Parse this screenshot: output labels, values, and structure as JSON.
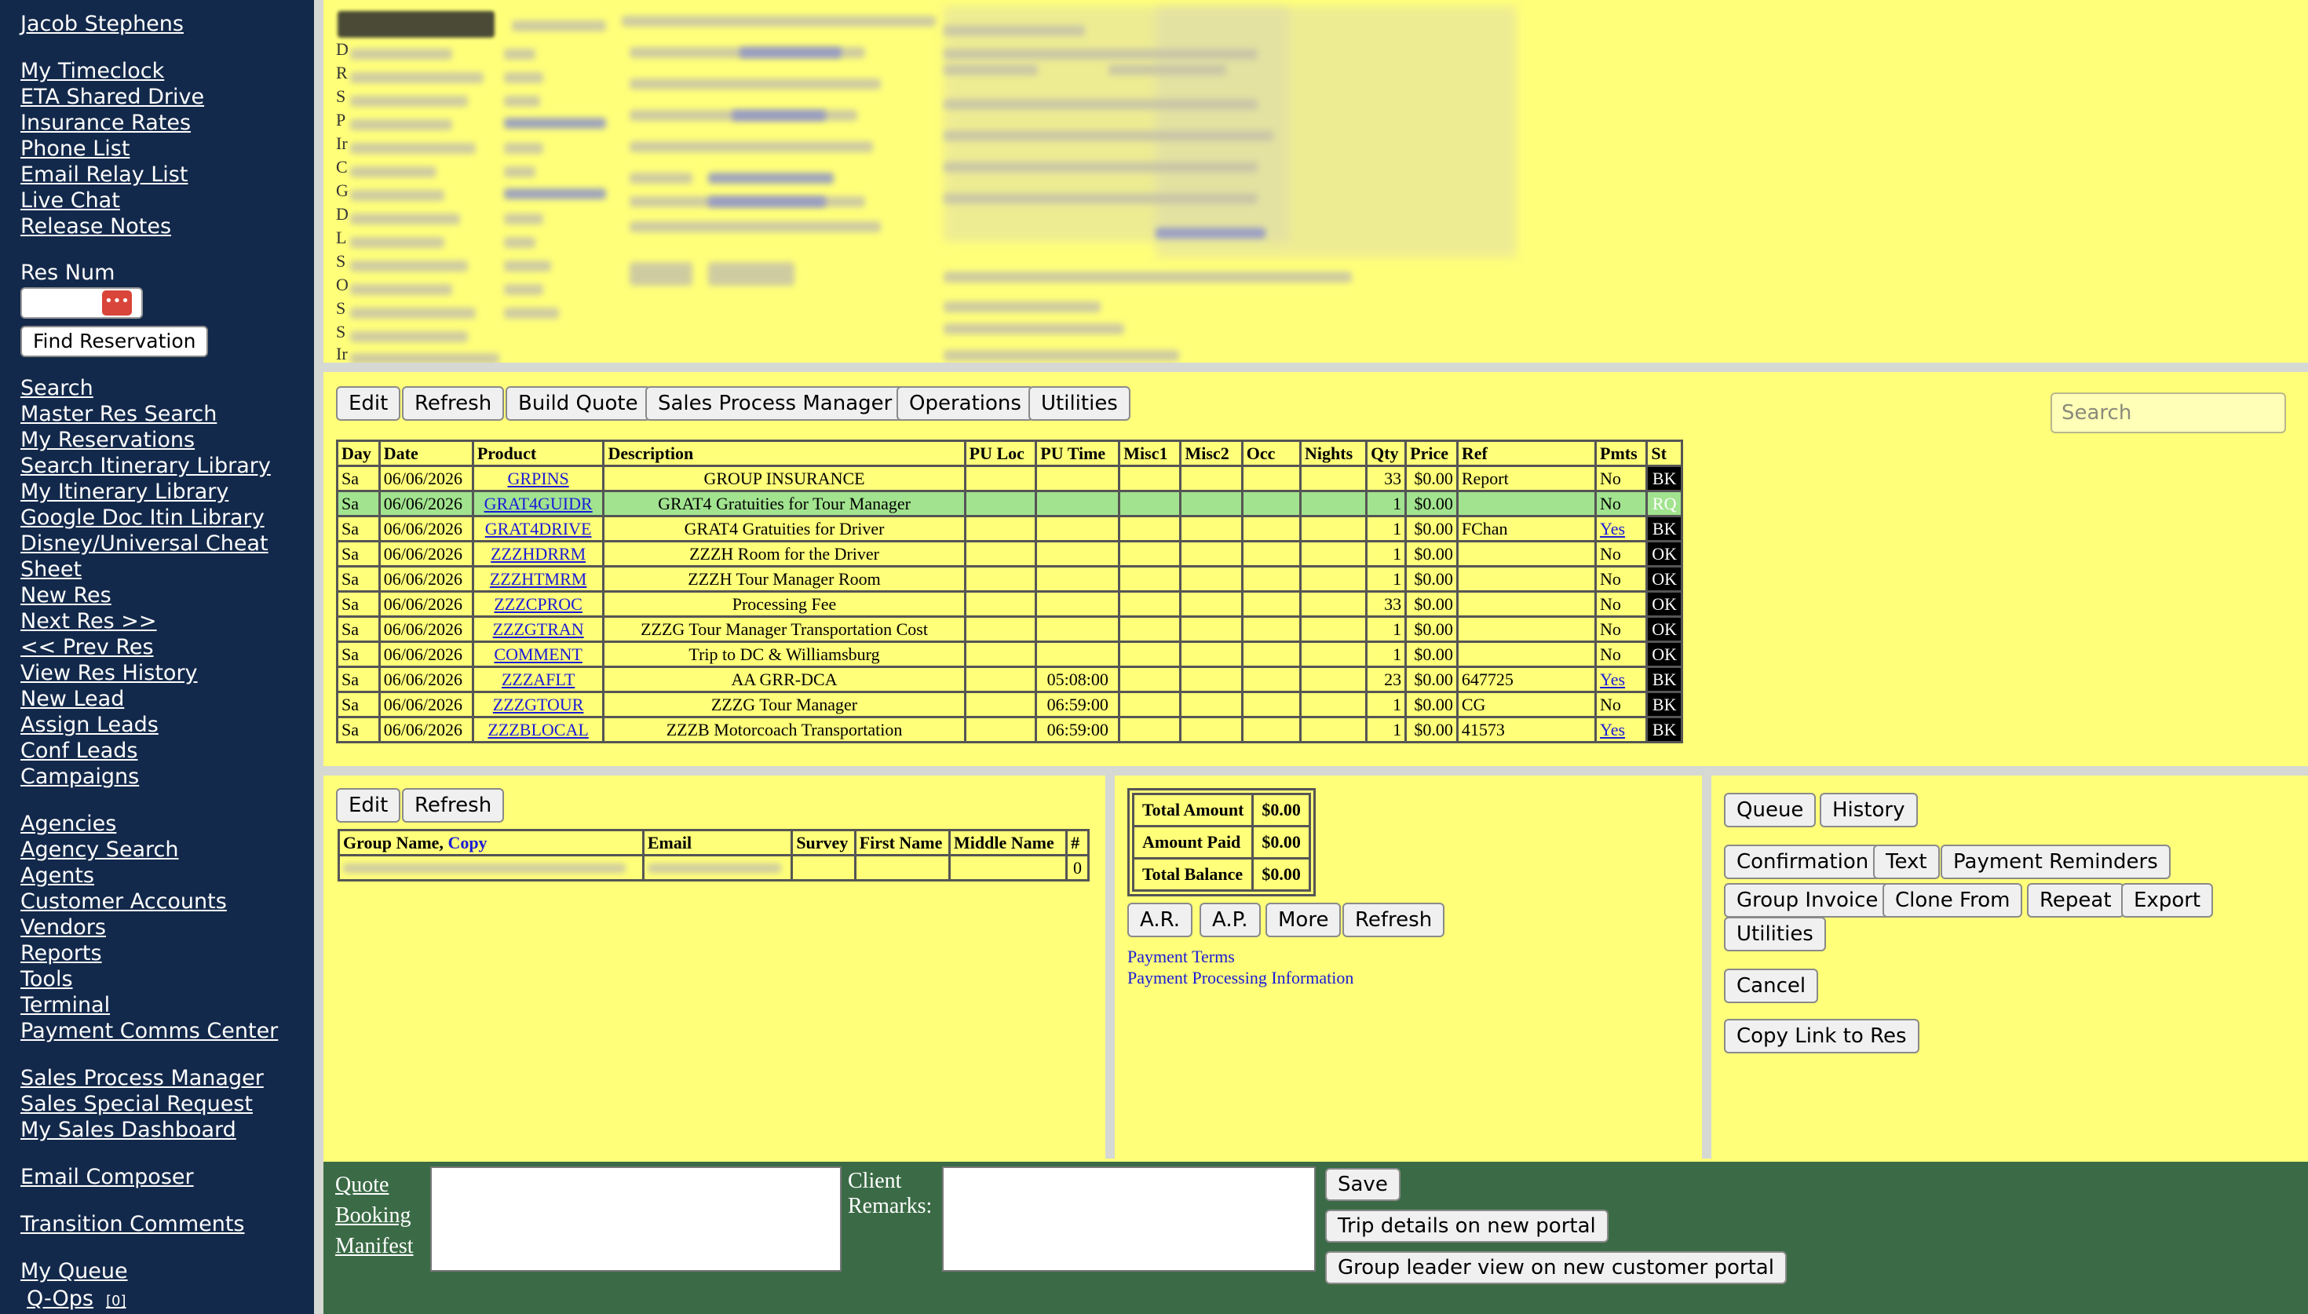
{
  "sidebar": {
    "user": "Jacob Stephens",
    "links_1": [
      "My Timeclock",
      "ETA Shared Drive",
      "Insurance Rates",
      "Phone List",
      "Email Relay List",
      "Live Chat",
      "Release Notes"
    ],
    "res_num_label": "Res Num",
    "find_button": "Find Reservation",
    "links_2": [
      "Search",
      "Master Res Search",
      "My Reservations",
      "Search Itinerary Library",
      "My Itinerary Library",
      "Google Doc Itin Library",
      "Disney/Universal Cheat",
      "Sheet",
      "New Res",
      "Next Res >>",
      "<< Prev Res",
      "View Res History",
      "New Lead",
      "Assign Leads",
      "Conf Leads",
      "Campaigns"
    ],
    "links_3": [
      "Agencies",
      "Agency Search",
      "Agents",
      "Customer Accounts",
      "Vendors",
      "Reports",
      "Tools",
      "Terminal",
      "Payment Comms Center"
    ],
    "links_4": [
      "Sales Process Manager",
      "Sales Special Request",
      "My Sales Dashboard"
    ],
    "email_composer": "Email Composer",
    "transition_comments": "Transition Comments",
    "my_queue": "My Queue",
    "q_ops": "Q-Ops",
    "q_ops_count": "[0]"
  },
  "header_initials": [
    "D",
    "R",
    "S",
    "P",
    "Ir",
    "C",
    "G",
    "D",
    "L",
    "S",
    "O",
    "S",
    "S",
    "Ir"
  ],
  "toolbar": {
    "buttons": [
      "Edit",
      "Refresh",
      "Build Quote",
      "Sales Process Manager",
      "Operations",
      "Utilities"
    ],
    "search_placeholder": "Search"
  },
  "itinerary": {
    "columns": [
      "Day",
      "Date",
      "Product",
      "Description",
      "PU Loc",
      "PU Time",
      "Misc1",
      "Misc2",
      "Occ",
      "Nights",
      "Qty",
      "Price",
      "Ref",
      "Pmts",
      "St"
    ],
    "rows": [
      {
        "day": "Sa",
        "date": "06/06/2026",
        "product": "GRPINS",
        "description": "GROUP INSURANCE",
        "pu_time": "",
        "qty": "33",
        "price": "$0.00",
        "ref": "Report",
        "pmts": "No",
        "st": "BK",
        "highlight": false
      },
      {
        "day": "Sa",
        "date": "06/06/2026",
        "product": "GRAT4GUIDR",
        "description": "GRAT4 Gratuities for Tour Manager",
        "pu_time": "",
        "qty": "1",
        "price": "$0.00",
        "ref": "",
        "pmts": "No",
        "st": "RQ",
        "highlight": true
      },
      {
        "day": "Sa",
        "date": "06/06/2026",
        "product": "GRAT4DRIVE",
        "description": "GRAT4 Gratuities for Driver",
        "pu_time": "",
        "qty": "1",
        "price": "$0.00",
        "ref": "FChan",
        "pmts": "Yes",
        "st": "BK",
        "highlight": false
      },
      {
        "day": "Sa",
        "date": "06/06/2026",
        "product": "ZZZHDRRM",
        "description": "ZZZH Room for the Driver",
        "pu_time": "",
        "qty": "1",
        "price": "$0.00",
        "ref": "",
        "pmts": "No",
        "st": "OK",
        "highlight": false
      },
      {
        "day": "Sa",
        "date": "06/06/2026",
        "product": "ZZZHTMRM",
        "description": "ZZZH Tour Manager Room",
        "pu_time": "",
        "qty": "1",
        "price": "$0.00",
        "ref": "",
        "pmts": "No",
        "st": "OK",
        "highlight": false
      },
      {
        "day": "Sa",
        "date": "06/06/2026",
        "product": "ZZZCPROC",
        "description": "Processing Fee",
        "pu_time": "",
        "qty": "33",
        "price": "$0.00",
        "ref": "",
        "pmts": "No",
        "st": "OK",
        "highlight": false
      },
      {
        "day": "Sa",
        "date": "06/06/2026",
        "product": "ZZZGTRAN",
        "description": "ZZZG Tour Manager Transportation Cost",
        "pu_time": "",
        "qty": "1",
        "price": "$0.00",
        "ref": "",
        "pmts": "No",
        "st": "OK",
        "highlight": false
      },
      {
        "day": "Sa",
        "date": "06/06/2026",
        "product": "COMMENT",
        "description": "Trip to DC & Williamsburg",
        "pu_time": "",
        "qty": "1",
        "price": "$0.00",
        "ref": "",
        "pmts": "No",
        "st": "OK",
        "highlight": false
      },
      {
        "day": "Sa",
        "date": "06/06/2026",
        "product": "ZZZAFLT",
        "description": "AA GRR-DCA",
        "pu_time": "05:08:00",
        "qty": "23",
        "price": "$0.00",
        "ref": "647725",
        "pmts": "Yes",
        "st": "BK",
        "highlight": false
      },
      {
        "day": "Sa",
        "date": "06/06/2026",
        "product": "ZZZGTOUR",
        "description": "ZZZG Tour Manager",
        "pu_time": "06:59:00",
        "qty": "1",
        "price": "$0.00",
        "ref": "CG",
        "pmts": "No",
        "st": "BK",
        "highlight": false
      },
      {
        "day": "Sa",
        "date": "06/06/2026",
        "product": "ZZZBLOCAL",
        "description": "ZZZB Motorcoach Transportation",
        "pu_time": "06:59:00",
        "qty": "1",
        "price": "$0.00",
        "ref": "41573",
        "pmts": "Yes",
        "st": "BK",
        "highlight": false
      }
    ]
  },
  "group_panel": {
    "buttons": [
      "Edit",
      "Refresh"
    ],
    "group_name_header": "Group Name,",
    "copy_link": "Copy",
    "columns": [
      "Email",
      "Survey",
      "First Name",
      "Middle Name",
      "#"
    ],
    "row_count": "0"
  },
  "payment_panel": {
    "totals": [
      {
        "label": "Total Amount",
        "value": "$0.00"
      },
      {
        "label": "Amount Paid",
        "value": "$0.00"
      },
      {
        "label": "Total Balance",
        "value": "$0.00"
      }
    ],
    "buttons": [
      "A.R.",
      "A.P.",
      "More",
      "Refresh"
    ],
    "links": [
      "Payment Terms",
      "Payment Processing Information"
    ]
  },
  "actions_panel": {
    "row1": [
      "Queue",
      "History"
    ],
    "row2": [
      "Confirmation",
      "Text",
      "Payment Reminders"
    ],
    "row3": [
      "Group Invoice",
      "Clone From",
      "Repeat",
      "Export"
    ],
    "row4": [
      "Utilities"
    ],
    "cancel": "Cancel",
    "copy_link": "Copy Link to Res"
  },
  "footer": {
    "links": [
      "Quote",
      "Booking",
      "Manifest"
    ],
    "client_remarks_label_1": "Client",
    "client_remarks_label_2": "Remarks:",
    "save": "Save",
    "trip_details": "Trip details on new portal",
    "group_leader_view": "Group leader view on new customer portal"
  },
  "colors": {
    "sidebar_bg": "#13294b",
    "page_bg": "#ffff7a",
    "highlight_row": "#a2e38f",
    "footer_bg": "#3b6b46",
    "status_bg": "#000000",
    "link": "#1b1bd6"
  }
}
